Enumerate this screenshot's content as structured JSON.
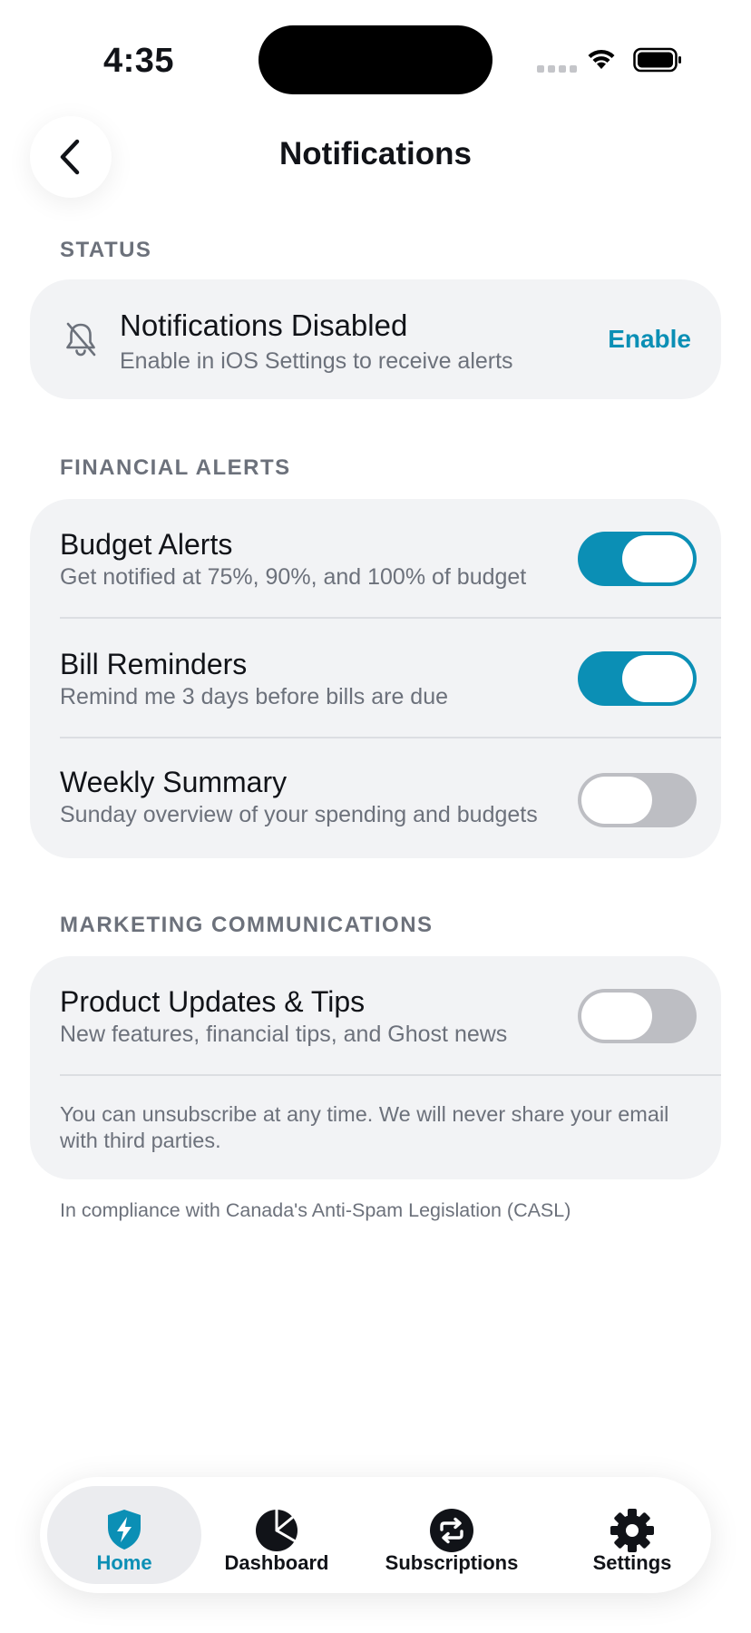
{
  "status_bar": {
    "time": "4:35"
  },
  "header": {
    "title": "Notifications"
  },
  "status_section": {
    "label": "STATUS",
    "title": "Notifications Disabled",
    "subtitle": "Enable in iOS Settings to receive alerts",
    "action": "Enable"
  },
  "financial_section": {
    "label": "FINANCIAL ALERTS",
    "items": [
      {
        "title": "Budget Alerts",
        "subtitle": "Get notified at 75%, 90%, and 100% of budget",
        "enabled": true
      },
      {
        "title": "Bill Reminders",
        "subtitle": "Remind me 3 days before bills are due",
        "enabled": true
      },
      {
        "title": "Weekly Summary",
        "subtitle": "Sunday overview of your spending and budgets",
        "enabled": false
      }
    ]
  },
  "marketing_section": {
    "label": "MARKETING COMMUNICATIONS",
    "items": [
      {
        "title": "Product Updates & Tips",
        "subtitle": "New features, financial tips, and Ghost news",
        "enabled": false
      }
    ],
    "note": "You can unsubscribe at any time. We will never share your email with third parties."
  },
  "footnote": "In compliance with Canada's Anti-Spam Legislation (CASL)",
  "tab_bar": {
    "tabs": [
      {
        "label": "Home",
        "icon": "shield-bolt-icon",
        "active": true
      },
      {
        "label": "Dashboard",
        "icon": "pie-chart-icon",
        "active": false
      },
      {
        "label": "Subscriptions",
        "icon": "repeat-icon",
        "active": false
      },
      {
        "label": "Settings",
        "icon": "gear-icon",
        "active": false
      }
    ]
  },
  "colors": {
    "accent": "#0b8fb5",
    "toggle_off": "#bdbec3",
    "card_background": "#f2f3f5",
    "secondary_text": "#6c717b"
  }
}
